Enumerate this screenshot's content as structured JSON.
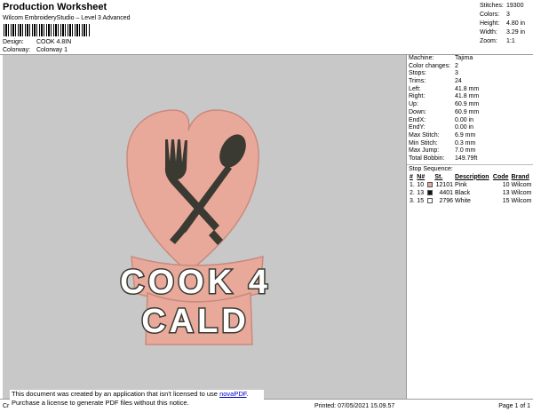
{
  "header": {
    "title": "Production Worksheet",
    "subtitle": "Wilcom EmbroideryStudio – Level 3 Advanced",
    "design_label": "Design:",
    "design_value": "COOK 4.8IN",
    "colorway_label": "Colorway:",
    "colorway_value": "Colorway 1"
  },
  "stitch_info": [
    {
      "label": "Stitches:",
      "value": "19300"
    },
    {
      "label": "Colors:",
      "value": "3"
    },
    {
      "label": "Height:",
      "value": "4.80 in"
    },
    {
      "label": "Width:",
      "value": "3.29 in"
    },
    {
      "label": "Zoom:",
      "value": "1:1"
    }
  ],
  "design": {
    "text_line1": "COOK 4",
    "text_line2": "CALD",
    "colors": {
      "pink": "#e9a99a",
      "black": "#3a3a32",
      "canvas": "#c8c8c8"
    }
  },
  "specs": [
    {
      "label": "Machine:",
      "value": "Tajima"
    },
    {
      "label": "Color changes:",
      "value": "2"
    },
    {
      "label": "Stops:",
      "value": "3"
    },
    {
      "label": "Trims:",
      "value": "24"
    },
    {
      "label": "Left:",
      "value": "41.8 mm"
    },
    {
      "label": "Right:",
      "value": "41.8 mm"
    },
    {
      "label": "Up:",
      "value": "60.9 mm"
    },
    {
      "label": "Down:",
      "value": "60.9 mm"
    },
    {
      "label": "EndX:",
      "value": "0.00 in"
    },
    {
      "label": "EndY:",
      "value": "0.00 in"
    },
    {
      "label": "Max Stitch:",
      "value": "6.9 mm"
    },
    {
      "label": "Min Stitch:",
      "value": "0.3 mm"
    },
    {
      "label": "Max Jump:",
      "value": "7.0 mm"
    },
    {
      "label": "Total Bobbin:",
      "value": "149.79ft"
    }
  ],
  "stop_sequence": {
    "title": "Stop Sequence:",
    "headers": [
      "#",
      "N#",
      "St.",
      "Description",
      "Code",
      "Brand"
    ],
    "rows": [
      {
        "num": "1.",
        "n": "10",
        "swatch": "#e9a99a",
        "st": "12101",
        "desc": "Pink",
        "code": "10",
        "brand": "Wilcom"
      },
      {
        "num": "2.",
        "n": "13",
        "swatch": "#111111",
        "st": "4401",
        "desc": "Black",
        "code": "13",
        "brand": "Wilcom"
      },
      {
        "num": "3.",
        "n": "15",
        "swatch": "#ffffff",
        "st": "2796",
        "desc": "White",
        "code": "15",
        "brand": "Wilcom"
      }
    ]
  },
  "footer": {
    "left": "Cr",
    "printed": "Printed: 07/05/2021 15.09.57",
    "page": "Page 1 of 1",
    "notice_line1_a": "This document was created by an application that isn't licensed to use ",
    "notice_link": "novaPDF",
    "notice_line1_b": ".",
    "notice_line2": "Purchase a license to generate PDF files without this notice."
  }
}
